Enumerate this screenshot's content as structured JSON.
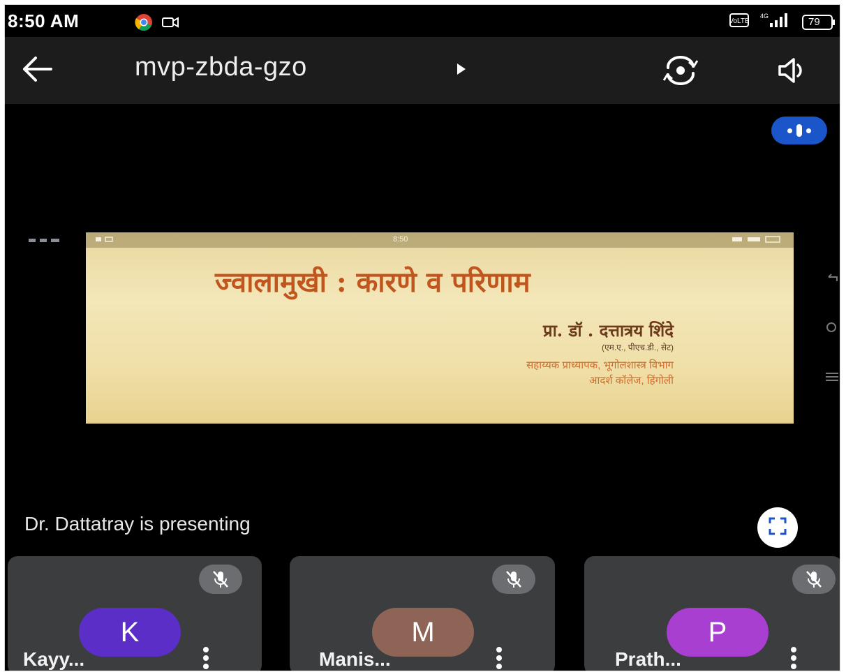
{
  "status_bar": {
    "time": "8:50 AM",
    "battery": "79",
    "network": "4G"
  },
  "header": {
    "meeting_code": "mvp-zbda-gzo",
    "back_icon": "arrow-left-icon",
    "flip_icon": "camera-flip-icon",
    "speaker_icon": "speaker-icon"
  },
  "slide": {
    "status_time": "8:50",
    "title": "ज्वालामुखी : कारणे व परिणाम",
    "author": "प्रा. डॉ . दत्तात्रय शिंदे",
    "degrees": "(एम.ए., पीएच.डी., सेट)",
    "line1": "सहाय्यक प्राध्यापक, भूगोलशास्त्र विभाग",
    "line2": "आदर्श कॉलेज, हिंगोली"
  },
  "presenting_text": "Dr. Dattatray is presenting",
  "participants": [
    {
      "initial": "K",
      "name": "Kayy...",
      "color": "#5b2ec7",
      "muted": true
    },
    {
      "initial": "M",
      "name": "Manis...",
      "color": "#8d6455",
      "muted": true
    },
    {
      "initial": "P",
      "name": "Prath...",
      "color": "#a83fd1",
      "muted": true
    }
  ],
  "colors": {
    "accent": "#1a56c9",
    "tile_bg": "#3c3d3f",
    "topbar_bg": "#1c1c1c"
  }
}
